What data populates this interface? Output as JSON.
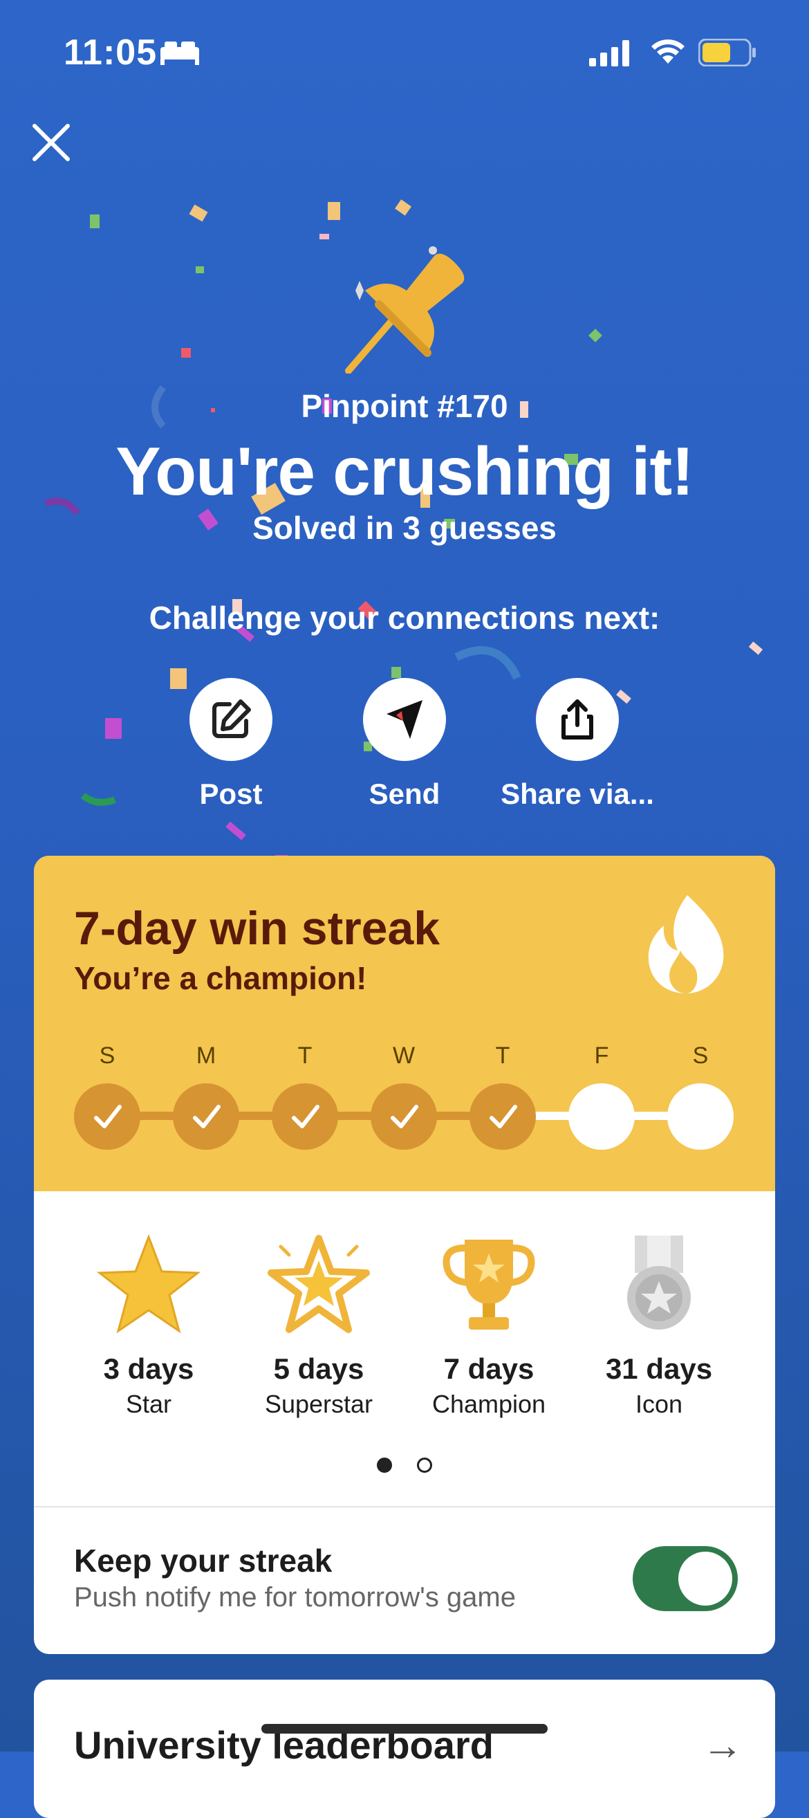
{
  "status": {
    "time": "11:05"
  },
  "result": {
    "puzzle_number": "Pinpoint #170",
    "headline": "You're crushing it!",
    "subline": "Solved in 3 guesses",
    "challenge": "Challenge your connections next:"
  },
  "share": {
    "post": "Post",
    "send": "Send",
    "share_via": "Share via..."
  },
  "streak": {
    "title": "7-day win streak",
    "subtitle": "You’re a champion!",
    "days": [
      {
        "letter": "S",
        "done": true
      },
      {
        "letter": "M",
        "done": true
      },
      {
        "letter": "T",
        "done": true
      },
      {
        "letter": "W",
        "done": true
      },
      {
        "letter": "T",
        "done": true
      },
      {
        "letter": "F",
        "done": false
      },
      {
        "letter": "S",
        "done": false
      }
    ]
  },
  "badges": [
    {
      "days": "3 days",
      "name": "Star",
      "icon": "star-icon"
    },
    {
      "days": "5 days",
      "name": "Superstar",
      "icon": "superstar-icon"
    },
    {
      "days": "7 days",
      "name": "Champion",
      "icon": "trophy-icon"
    },
    {
      "days": "31 days",
      "name": "Icon",
      "icon": "medal-icon"
    }
  ],
  "pager": {
    "pages": 2,
    "active": 1
  },
  "notify": {
    "title": "Keep your streak",
    "subtitle": "Push notify me for tomorrow's game",
    "enabled": true
  },
  "leaderboard": {
    "title": "University leaderboard"
  },
  "colors": {
    "background": "#2d66c8",
    "streak_yellow": "#f4c54f",
    "done_orange": "#d69432",
    "toggle_green": "#2f7a4b",
    "title_brown": "#5a1a0a"
  }
}
